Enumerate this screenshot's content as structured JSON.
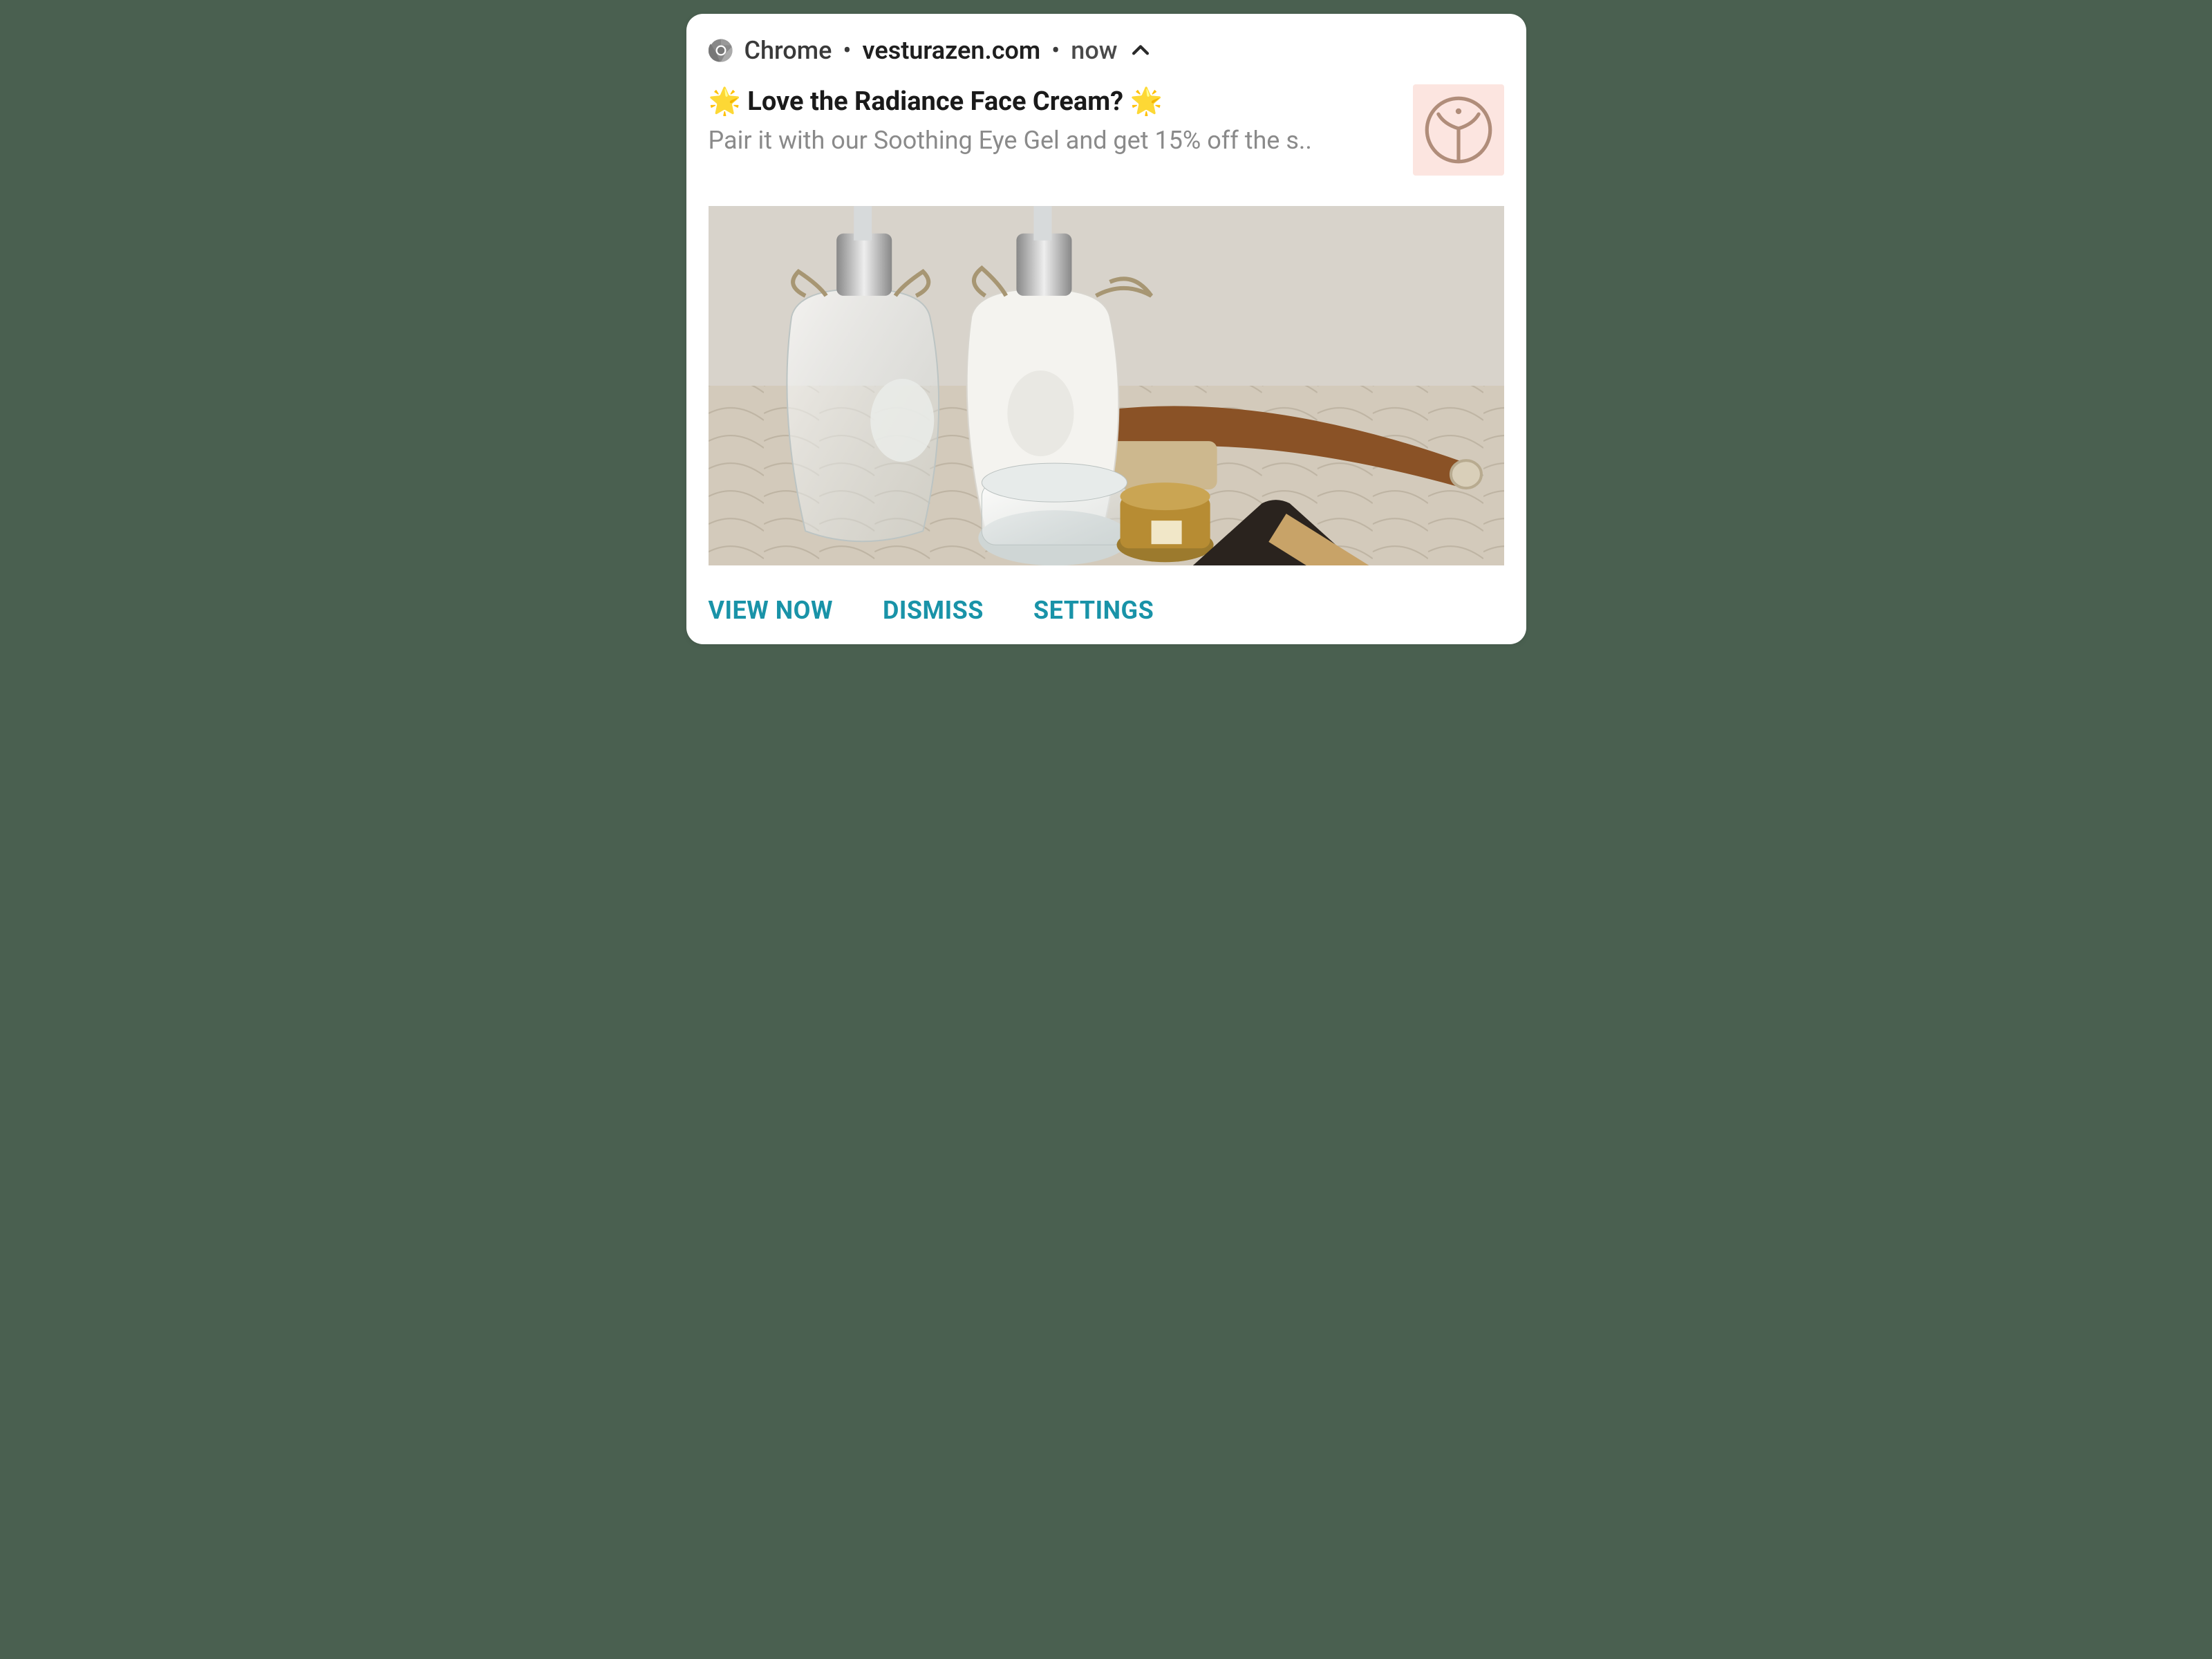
{
  "header": {
    "app_name": "Chrome",
    "domain": "vesturazen.com",
    "time": "now"
  },
  "notification": {
    "title": "🌟 Love the Radiance Face Cream? 🌟",
    "body": "Pair it with our Soothing Eye Gel and get 15% off the s.."
  },
  "actions": {
    "view": "VIEW NOW",
    "dismiss": "DISMISS",
    "settings": "SETTINGS"
  },
  "colors": {
    "action": "#1993a8",
    "badge_bg": "#fce5e0",
    "badge_ring": "#b08d7a"
  }
}
